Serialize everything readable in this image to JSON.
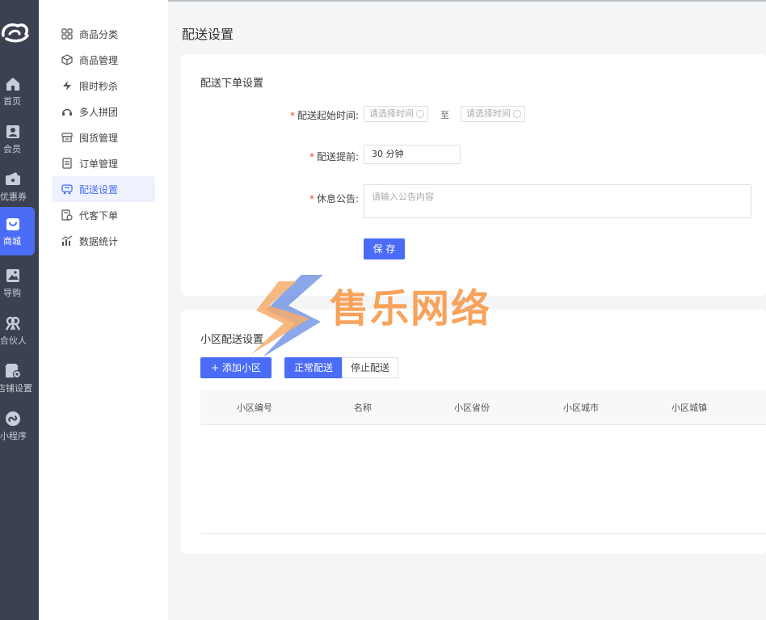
{
  "rail": {
    "items": [
      {
        "label": "首页",
        "icon": "home-icon"
      },
      {
        "label": "会员",
        "icon": "member-card-icon"
      },
      {
        "label": "优惠券",
        "icon": "coupon-icon"
      },
      {
        "label": "商城",
        "icon": "shopping-bag-icon",
        "active": true
      },
      {
        "label": "导购",
        "icon": "image-icon"
      },
      {
        "label": "合伙人",
        "icon": "partner-icon"
      },
      {
        "label": "店铺设置",
        "icon": "store-settings-icon"
      },
      {
        "label": "小程序",
        "icon": "mini-program-icon"
      }
    ]
  },
  "submenu": {
    "items": [
      {
        "label": "商品分类",
        "icon": "grid-icon"
      },
      {
        "label": "商品管理",
        "icon": "cube-icon"
      },
      {
        "label": "限时秒杀",
        "icon": "lightning-icon"
      },
      {
        "label": "多人拼团",
        "icon": "headset-icon"
      },
      {
        "label": "囤货管理",
        "icon": "storage-icon"
      },
      {
        "label": "订单管理",
        "icon": "order-icon"
      },
      {
        "label": "配送设置",
        "icon": "delivery-icon",
        "active": true
      },
      {
        "label": "代客下单",
        "icon": "proxy-order-icon"
      },
      {
        "label": "数据统计",
        "icon": "chart-icon"
      }
    ]
  },
  "page": {
    "title": "配送设置"
  },
  "order_settings": {
    "title": "配送下单设置",
    "start_time_label": "配送起始时间:",
    "start_placeholder": "请选择时间",
    "to_text": "至",
    "end_placeholder": "请选择时间",
    "advance_label": "配送提前:",
    "advance_value": "30 分钟",
    "notice_label": "休息公告:",
    "notice_placeholder": "请输入公告内容",
    "save_label": "保 存"
  },
  "community": {
    "title": "小区配送设置",
    "add_label": "+ 添加小区",
    "tabs": [
      "正常配送",
      "停止配送"
    ],
    "columns": [
      "小区编号",
      "名称",
      "小区省份",
      "小区城市",
      "小区城镇"
    ]
  },
  "watermark": {
    "text": "售乐网络"
  },
  "colors": {
    "accent": "#4a6cf7",
    "rail_bg": "#3b4150",
    "required": "#e8492e",
    "watermark": "#f8a25a"
  }
}
